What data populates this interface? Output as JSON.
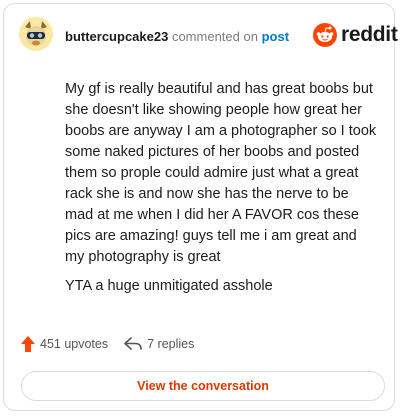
{
  "header": {
    "username": "buttercupcake23",
    "action_text": "commented on",
    "target_link": "post"
  },
  "brand": {
    "name": "reddit",
    "color": "#ff4500"
  },
  "comment": {
    "post_text": "My gf is really beautiful and has great boobs but she doesn't like showing people how great her boobs are anyway I am a photographer so I took some naked pictures of her boobs and posted them so prople could admire just what a great rack she is and now she has the nerve to be mad at me when I did her A FAVOR cos these pics are amazing! guys tell me i am great and my photography is great",
    "reply_text": "YTA a huge unmitigated asshole"
  },
  "stats": {
    "upvotes_label": "451 upvotes",
    "replies_label": "7 replies",
    "upvote_icon": "upvote-arrow-icon",
    "reply_icon": "reply-arrow-icon"
  },
  "actions": {
    "view_conversation_label": "View the conversation"
  },
  "colors": {
    "accent": "#d93a00",
    "link": "#0079d3",
    "upvote": "#ff4500",
    "avatar_bg": "#fbe7a6"
  }
}
